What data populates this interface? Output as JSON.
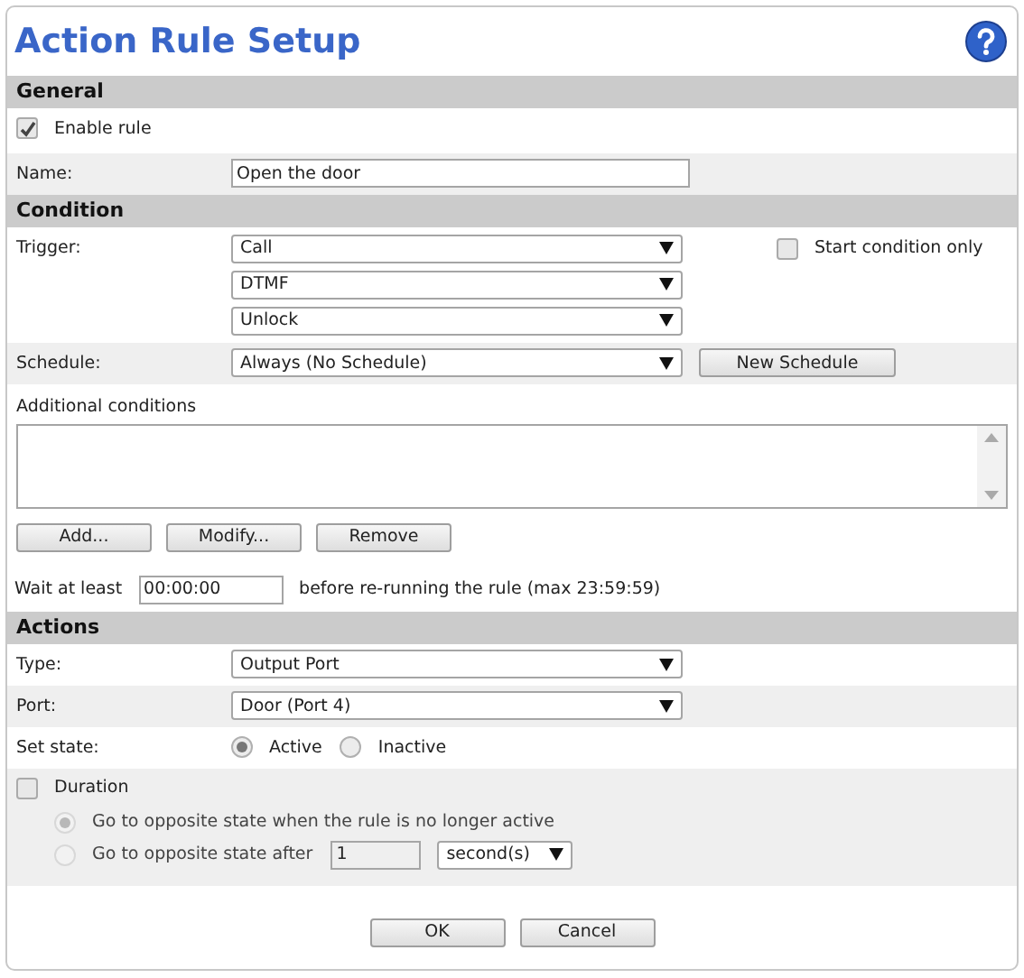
{
  "title": "Action Rule Setup",
  "general": {
    "heading": "General",
    "enable_rule": {
      "label": "Enable rule",
      "checked": true
    },
    "name": {
      "label": "Name:",
      "value": "Open the door"
    }
  },
  "condition": {
    "heading": "Condition",
    "trigger": {
      "label": "Trigger:",
      "values": [
        "Call",
        "DTMF",
        "Unlock"
      ]
    },
    "start_condition_only": {
      "label": "Start condition only",
      "checked": false
    },
    "schedule": {
      "label": "Schedule:",
      "value": "Always (No Schedule)",
      "button": "New Schedule"
    },
    "additional_conditions": {
      "label": "Additional conditions",
      "buttons": [
        "Add...",
        "Modify...",
        "Remove"
      ]
    },
    "wait": {
      "label": "Wait at least",
      "value": "00:00:00",
      "suffix": "before re-running the rule (max 23:59:59)"
    }
  },
  "actions": {
    "heading": "Actions",
    "type": {
      "label": "Type:",
      "value": "Output Port"
    },
    "port": {
      "label": "Port:",
      "value": "Door (Port 4)"
    },
    "set_state": {
      "label": "Set state:",
      "options": [
        {
          "label": "Active",
          "selected": true
        },
        {
          "label": "Inactive",
          "selected": false
        }
      ]
    },
    "duration": {
      "label": "Duration",
      "checked": false,
      "options": [
        {
          "label": "Go to opposite state when the rule is no longer active",
          "selected": true,
          "disabled": true
        },
        {
          "label": "Go to opposite state after",
          "selected": false,
          "disabled": true
        }
      ],
      "after_value": "1",
      "unit": "second(s)"
    }
  },
  "buttons": [
    "OK",
    "Cancel"
  ]
}
